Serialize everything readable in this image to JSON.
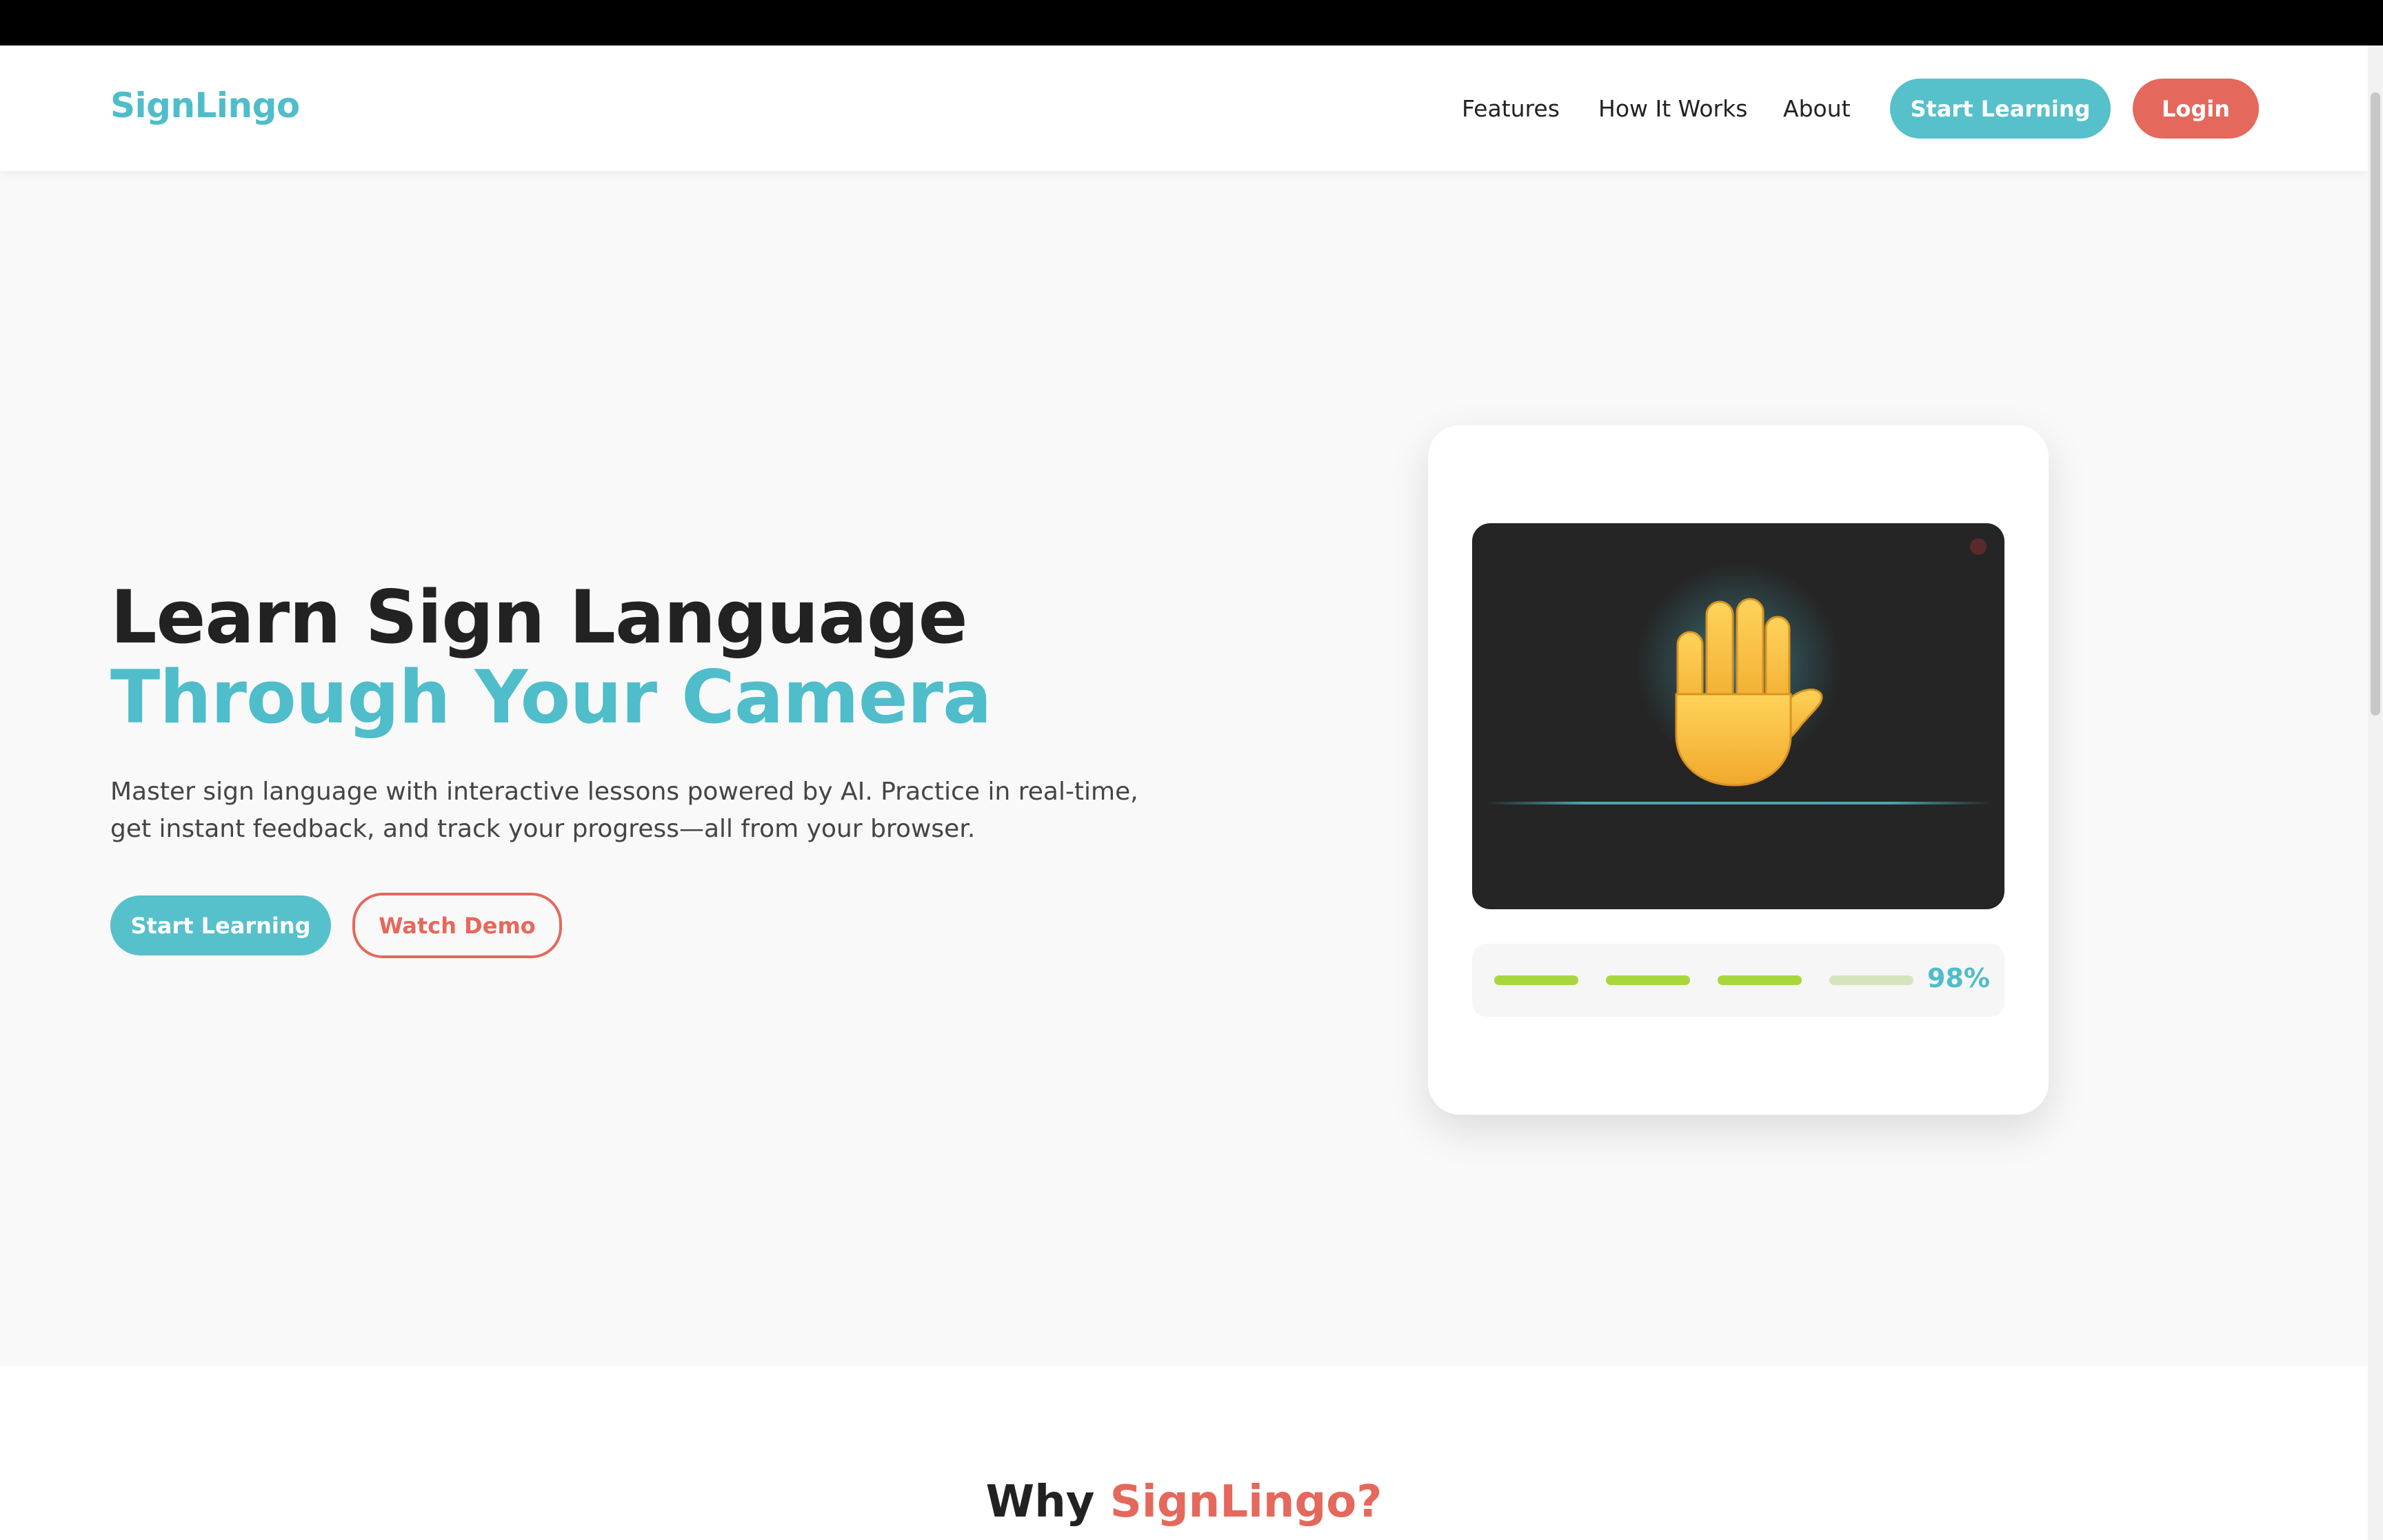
{
  "nav": {
    "logo": "SignLingo",
    "links": [
      "Features",
      "How It Works",
      "About"
    ],
    "start_label": "Start Learning",
    "login_label": "Login"
  },
  "hero": {
    "title_part1": "Learn Sign Language ",
    "title_accent": "Through Your Camera",
    "subtitle": "Master sign language with interactive lessons powered by AI. Practice in real-time, get instant feedback, and track your progress—all from your browser.",
    "primary_button": "Start Learning",
    "secondary_button": "Watch Demo"
  },
  "demo_card": {
    "icon": "raised-hand-icon",
    "accuracy": "98%",
    "progress_segments_filled": 3,
    "progress_segments_total": 4
  },
  "why": {
    "title_part1": "Why ",
    "title_accent": "SignLingo?"
  },
  "colors": {
    "teal": "#4fbdca",
    "coral": "#e5685c",
    "lime": "#a6d83e"
  }
}
